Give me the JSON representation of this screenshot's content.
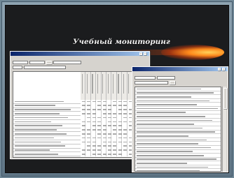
{
  "slide": {
    "title": "Учебный мониторинг"
  },
  "window_left": {
    "title": "",
    "menu": [
      "",
      "",
      "",
      ""
    ],
    "rows": 14,
    "columns": 11
  },
  "window_right": {
    "title": "",
    "menu": [
      "",
      "",
      ""
    ],
    "rows": 22
  },
  "colors": {
    "frame": "#6f8796",
    "slide_bg": "#1b1c1e",
    "title_glow": "#ff8a1c",
    "window_bg": "#d6d3ce",
    "titlebar": "#0a246a"
  }
}
